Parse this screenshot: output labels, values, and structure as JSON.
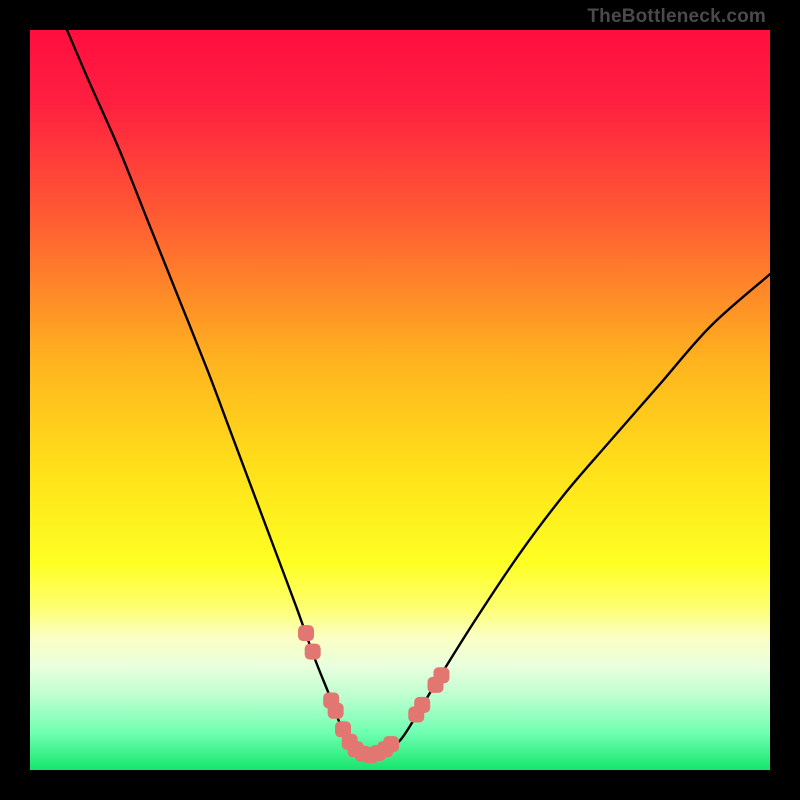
{
  "watermark": "TheBottleneck.com",
  "chart_data": {
    "type": "line",
    "title": "",
    "xlabel": "",
    "ylabel": "",
    "xlim": [
      0,
      100
    ],
    "ylim": [
      0,
      100
    ],
    "gradient_stops": [
      {
        "pct": 0,
        "color": "#ff0e3e"
      },
      {
        "pct": 10,
        "color": "#ff2040"
      },
      {
        "pct": 25,
        "color": "#ff5a33"
      },
      {
        "pct": 45,
        "color": "#ffb41f"
      },
      {
        "pct": 60,
        "color": "#ffe21a"
      },
      {
        "pct": 72,
        "color": "#feff22"
      },
      {
        "pct": 78,
        "color": "#feff70"
      },
      {
        "pct": 82,
        "color": "#fbffc2"
      },
      {
        "pct": 86,
        "color": "#e9ffde"
      },
      {
        "pct": 90,
        "color": "#bdffcf"
      },
      {
        "pct": 95,
        "color": "#6fffb1"
      },
      {
        "pct": 100,
        "color": "#15e66c"
      }
    ],
    "series": [
      {
        "name": "curve",
        "x": [
          5,
          8,
          12,
          16,
          20,
          24,
          27,
          30,
          33,
          36,
          38.5,
          40.5,
          42,
          43.5,
          45,
          46.5,
          48,
          50,
          52,
          55,
          60,
          66,
          72,
          78,
          85,
          92,
          100
        ],
        "y": [
          100,
          93,
          84,
          74,
          64,
          54,
          46,
          38,
          30,
          22,
          15,
          10,
          6,
          3.5,
          2.2,
          2,
          2.5,
          4,
          7,
          12,
          20,
          29,
          37,
          44,
          52,
          60,
          67
        ]
      },
      {
        "name": "markers-left",
        "points": [
          {
            "x": 37.3,
            "y": 18.5
          },
          {
            "x": 38.2,
            "y": 16.0
          },
          {
            "x": 40.7,
            "y": 9.4
          },
          {
            "x": 41.3,
            "y": 8.0
          }
        ]
      },
      {
        "name": "markers-bottom",
        "points": [
          {
            "x": 42.3,
            "y": 5.5
          },
          {
            "x": 43.2,
            "y": 3.8
          },
          {
            "x": 44.0,
            "y": 2.8
          },
          {
            "x": 45.0,
            "y": 2.2
          },
          {
            "x": 46.0,
            "y": 2.0
          },
          {
            "x": 47.0,
            "y": 2.3
          },
          {
            "x": 48.0,
            "y": 2.8
          },
          {
            "x": 48.8,
            "y": 3.5
          }
        ]
      },
      {
        "name": "markers-right",
        "points": [
          {
            "x": 52.2,
            "y": 7.5
          },
          {
            "x": 53.0,
            "y": 8.8
          },
          {
            "x": 54.8,
            "y": 11.5
          },
          {
            "x": 55.6,
            "y": 12.8
          }
        ]
      }
    ],
    "marker_color": "#e17770",
    "curve_color": "#000000"
  }
}
